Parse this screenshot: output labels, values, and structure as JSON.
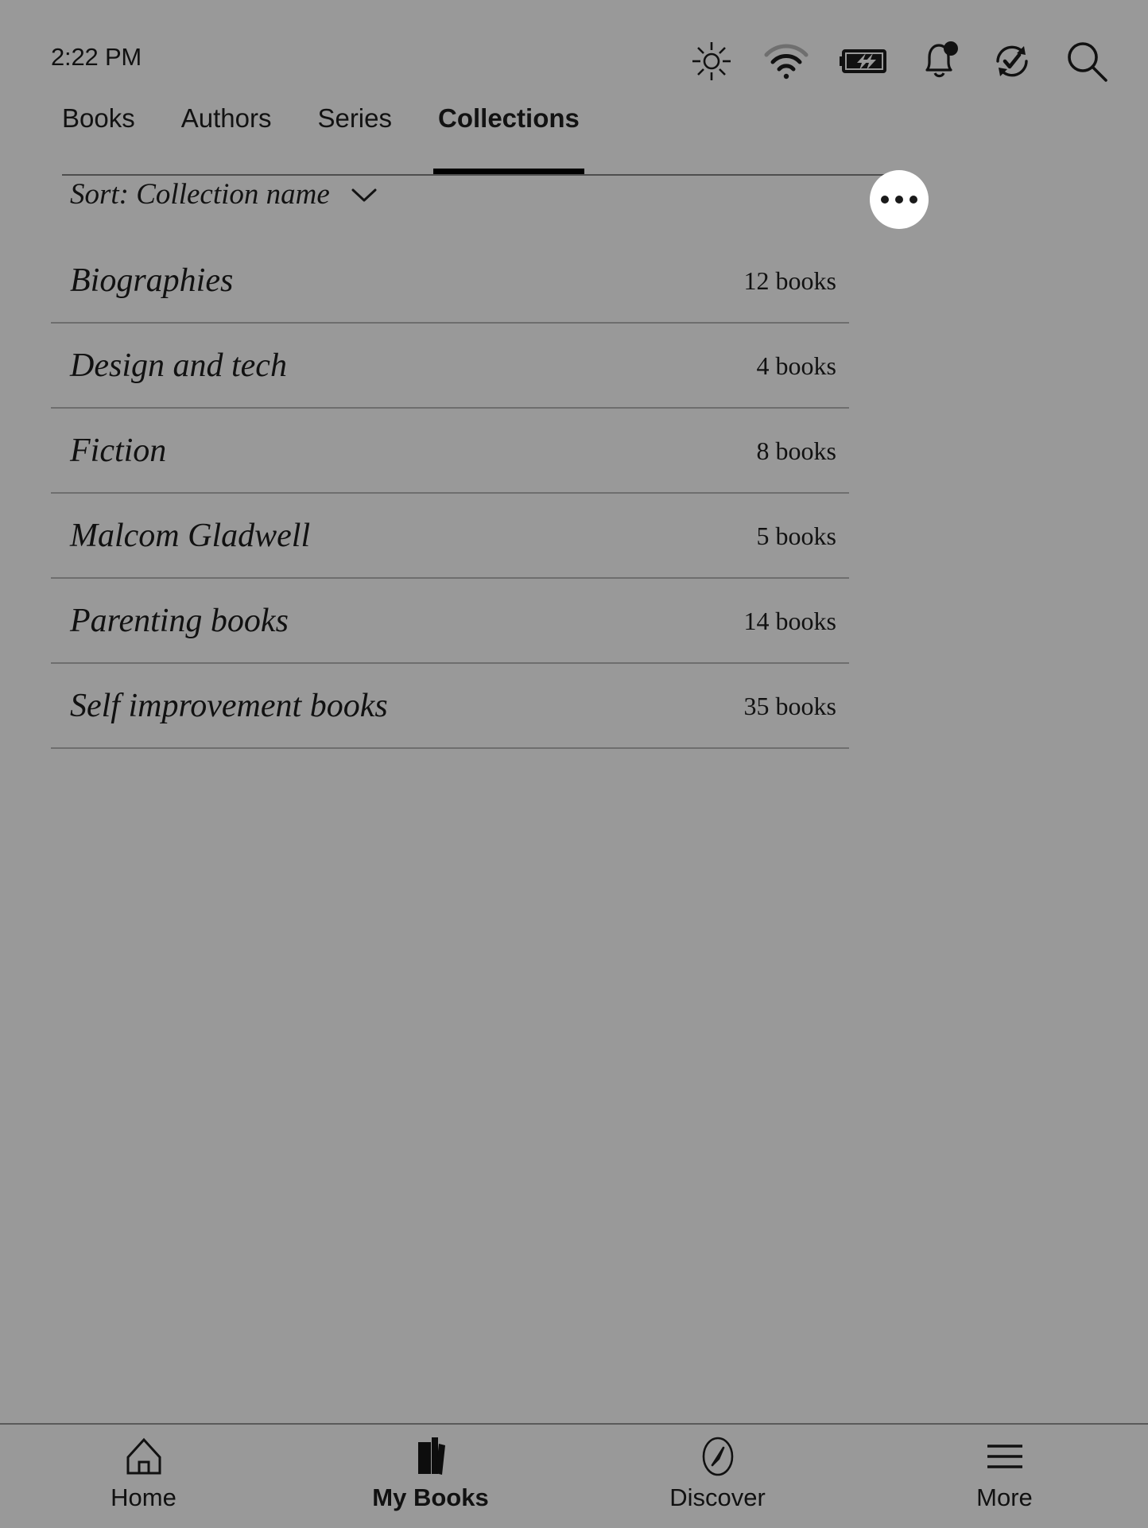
{
  "status_bar": {
    "time": "2:22 PM",
    "icons": [
      {
        "name": "brightness-icon",
        "label": "Brightness"
      },
      {
        "name": "wifi-icon",
        "label": "Wi-Fi"
      },
      {
        "name": "battery-charging-icon",
        "label": "Battery charging"
      },
      {
        "name": "notification-bell-icon",
        "label": "Notifications"
      },
      {
        "name": "sync-icon",
        "label": "Sync"
      },
      {
        "name": "search-icon",
        "label": "Search"
      }
    ]
  },
  "tabs": [
    {
      "label": "Books",
      "active": false
    },
    {
      "label": "Authors",
      "active": false
    },
    {
      "label": "Series",
      "active": false
    },
    {
      "label": "Collections",
      "active": true
    }
  ],
  "sort": {
    "label": "Sort: Collection name",
    "chevron": "chevron-down-icon"
  },
  "overflow": {
    "label": "More options",
    "glyph": "•••"
  },
  "collections": [
    {
      "name": "Biographies",
      "count": "12 books"
    },
    {
      "name": "Design and tech",
      "count": "4 books"
    },
    {
      "name": "Fiction",
      "count": "8 books"
    },
    {
      "name": "Malcom Gladwell",
      "count": "5 books"
    },
    {
      "name": "Parenting books",
      "count": "14 books"
    },
    {
      "name": "Self improvement books",
      "count": "35 books"
    }
  ],
  "bottom_nav": [
    {
      "label": "Home",
      "icon": "home-icon",
      "active": false
    },
    {
      "label": "My Books",
      "icon": "books-icon",
      "active": true
    },
    {
      "label": "Discover",
      "icon": "compass-icon",
      "active": false
    },
    {
      "label": "More",
      "icon": "hamburger-menu-icon",
      "active": false
    }
  ],
  "colors": {
    "background": "#999999",
    "text": "#111111",
    "divider": "#6e6e6e",
    "accent": "#000000",
    "button_fill": "#ffffff"
  }
}
